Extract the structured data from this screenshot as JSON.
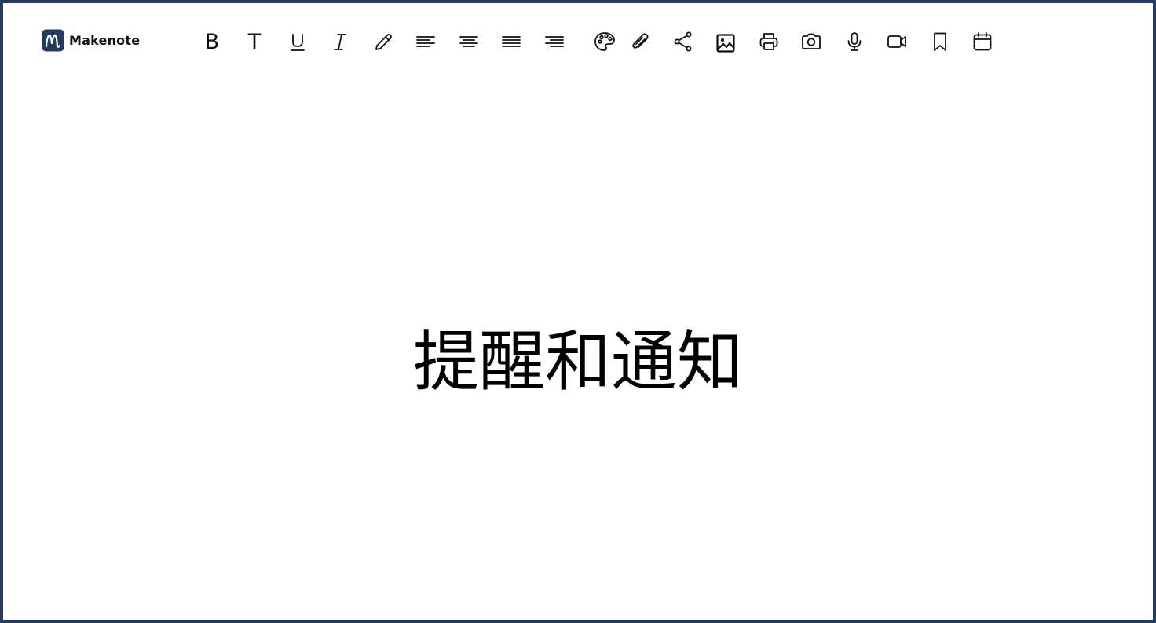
{
  "app": {
    "name": "Makenote",
    "brand_color": "#243a5e",
    "logo_icon": "makenote-m-logo"
  },
  "toolbar": {
    "buttons": [
      {
        "id": "bold",
        "icon": "bold-icon",
        "glyph": "B"
      },
      {
        "id": "text",
        "icon": "text-icon",
        "glyph": "T"
      },
      {
        "id": "underline",
        "icon": "underline-icon"
      },
      {
        "id": "italic",
        "icon": "italic-icon"
      },
      {
        "id": "pen",
        "icon": "pen-icon"
      },
      {
        "id": "align-left",
        "icon": "align-left-icon"
      },
      {
        "id": "align-center",
        "icon": "align-center-icon"
      },
      {
        "id": "align-justify",
        "icon": "align-justify-icon"
      },
      {
        "id": "align-right",
        "icon": "align-right-icon"
      },
      {
        "id": "color",
        "icon": "palette-icon"
      },
      {
        "id": "attach",
        "icon": "paperclip-icon"
      },
      {
        "id": "share",
        "icon": "share-icon"
      },
      {
        "id": "image",
        "icon": "image-icon"
      },
      {
        "id": "print",
        "icon": "printer-icon"
      },
      {
        "id": "camera",
        "icon": "camera-icon"
      },
      {
        "id": "microphone",
        "icon": "microphone-icon"
      },
      {
        "id": "video",
        "icon": "video-icon"
      },
      {
        "id": "bookmark",
        "icon": "bookmark-icon"
      },
      {
        "id": "calendar",
        "icon": "calendar-icon"
      }
    ]
  },
  "content": {
    "heading": "提醒和通知"
  }
}
